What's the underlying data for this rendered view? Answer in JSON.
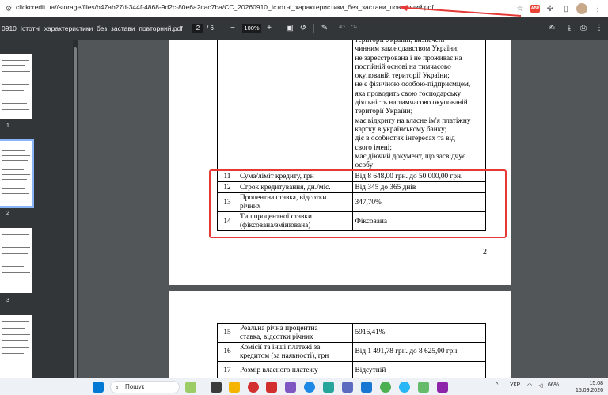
{
  "browser": {
    "url": "clickcredit.ua//storage/files/b47ab27d-344f-4868-9d2c-80e6a2cac7ba/CC_20260910_Істотні_характеристики_без_застави_повторний.pdf",
    "ext_badge": "ABP"
  },
  "pdf_toolbar": {
    "title": "0910_Істотні_характеристики_без_застави_повторний.pdf",
    "page_current": "2",
    "page_total": "/  6",
    "zoom": "100%",
    "minus": "−",
    "plus": "+"
  },
  "thumbnails": [
    {
      "label": "1"
    },
    {
      "label": "2"
    },
    {
      "label": "3"
    }
  ],
  "page2": {
    "top_rows": [
      "території України, визначені",
      "чинним законодавством України;",
      "не зареєстрована і не проживає на",
      "постійній основі на тимчасово",
      "окупованій території України;",
      "не є фізичною особою-підприємцем,",
      "яка проводить свою господарську",
      "діяльність на тимчасово окупованій",
      "території України;",
      "має відкриту на власне ім'я платіжну",
      "картку в українському банку;",
      "діє в особистих інтересах та від",
      "свого імені;",
      "має діючий документ, що засвідчує",
      "особу"
    ],
    "rows": [
      {
        "n": "11",
        "name": "Сума/ліміт кредиту, грн",
        "value": "Від 8 648,00 грн. до 50 000,00 грн."
      },
      {
        "n": "12",
        "name": "Строк кредитування, дн./міс.",
        "value": "Від 345 до 365 днів"
      },
      {
        "n": "13",
        "name1": "Процентна ставка, відсотки",
        "name2": "річних",
        "value": "347,70%"
      },
      {
        "n": "14",
        "name1": "Тип процентної ставки",
        "name2": "(фіксована/змінювана)",
        "value": "Фіксована"
      }
    ],
    "page_number": "2"
  },
  "page3": {
    "rows": [
      {
        "n": "15",
        "name1": "Реальна річна процентна",
        "name2": "ставка, відсотки річних",
        "value": "5916,41%"
      },
      {
        "n": "16",
        "name1": "Комісії та інші платежі за",
        "name2": "кредитом (за наявності), грн",
        "value": "Від 1 491,78 грн. до 8 625,00 грн."
      },
      {
        "n": "17",
        "name1": "Розмір власного платежу",
        "name2": "",
        "value": "Відсутній"
      }
    ]
  },
  "taskbar": {
    "search_label": "Пошук",
    "lang": "УКР",
    "battery": "66%",
    "time": "15:08",
    "date": "15.09.2026"
  },
  "colors": {
    "highlight_box": "#e53935",
    "pdf_toolbar_bg": "#323639",
    "viewer_bg": "#525659"
  }
}
